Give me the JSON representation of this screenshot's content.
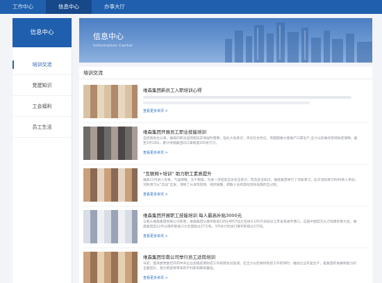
{
  "topnav": {
    "tabs": [
      {
        "label": "工作中心"
      },
      {
        "label": "信息中心"
      },
      {
        "label": "办事大厅"
      }
    ]
  },
  "sidebar": {
    "header": "信息中心",
    "items": [
      {
        "label": "培训交流"
      },
      {
        "label": "党建知识"
      },
      {
        "label": "工会福利"
      },
      {
        "label": "员工生活"
      }
    ]
  },
  "banner": {
    "title": "信息中心",
    "subtitle": "Information Center"
  },
  "content": {
    "section_title": "培训交流",
    "more_label": "查看更多资讯 >",
    "articles": [
      {
        "title": "维森集团新员工入职培训心得",
        "desc": ""
      },
      {
        "title": "维森集团开展员工职业技能培训",
        "desc": "自疫情发生以来，维森的职员坚持面向实情层时需要，强化大局意识，责任社会责任，克服困难大建维产口罩生产,全力以赴做好疫情防控保障。截至3月19日，累计供销集团向口罩数量200余万只。"
      },
      {
        "title": "“互联网+培训” 助力职工素质提升",
        "desc": "维森12月进入冬季，气温骤降，天干物燥，为进一步提高全员安全意识，普及安全知识，维森集团举行了消防演习，此次消防演习约60余人参加，消防演习从“实战”出发，演练了从发现险情、组织报警、疏散人员到其他消防设施的全过程。"
      },
      {
        "title": "维森集团开展职工技能培训 每人最高补贴3000元",
        "desc": "记者从维森集团有限公司获悉，维森集团从俄罗斯进口的14857吨大豆将于2月25日抵达江苏省南通市港口，这是中国首次从万吨俄罗斯大豆。维森集团自12月从俄罗斯进口大豆量超过27万吨，3月份计划进口俄罗斯超过2万吨。"
      },
      {
        "title": "维森集团华南公司举行员工适岗培训",
        "desc": "日前，国资委党委召开的中央企业加强疫情防控工作视频会议强调，在全力以赴做好防控工作的同时，推进企业开复生产，是集团的发展和能力的全面提升，努力把疫情带来的不利影响降到最低。"
      }
    ]
  },
  "colors": {
    "primary": "#1f5fae",
    "primary_dark": "#17488a",
    "link": "#2a6fc9"
  }
}
